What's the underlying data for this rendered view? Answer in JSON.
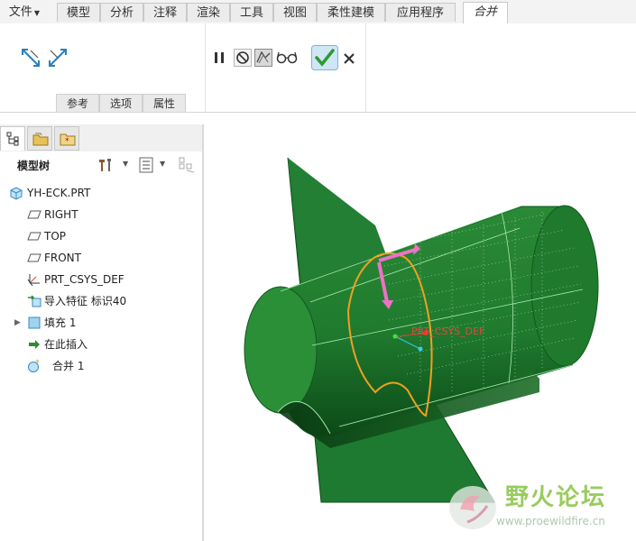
{
  "menu": {
    "file": "文件",
    "tabs": [
      "模型",
      "分析",
      "注释",
      "渲染",
      "工具",
      "视图",
      "柔性建模",
      "应用程序"
    ],
    "active": "合并"
  },
  "ribbon": {
    "subtabs": [
      "参考",
      "选项",
      "属性"
    ]
  },
  "panel": {
    "title": "模型树",
    "items": [
      {
        "label": "YH-ECK.PRT",
        "icon": "part-icon"
      },
      {
        "label": "RIGHT",
        "icon": "datum-plane-icon"
      },
      {
        "label": "TOP",
        "icon": "datum-plane-icon"
      },
      {
        "label": "FRONT",
        "icon": "datum-plane-icon"
      },
      {
        "label": "PRT_CSYS_DEF",
        "icon": "csys-icon"
      },
      {
        "label": "导入特征 标识40",
        "icon": "import-feature-icon"
      },
      {
        "label": "填充 1",
        "icon": "fill-icon"
      },
      {
        "label": "在此插入",
        "icon": "insert-arrow-icon"
      },
      {
        "label": "合并 1",
        "icon": "merge-icon"
      }
    ]
  },
  "viewport": {
    "csys_label": "PRT_CSYS_DEF"
  },
  "watermark": {
    "title": "野火论坛",
    "url": "www.proewildfire.cn"
  },
  "colors": {
    "model_green": "#1e7a30",
    "edge_orange": "#f0a020",
    "accept_green": "#2f9a2f"
  }
}
